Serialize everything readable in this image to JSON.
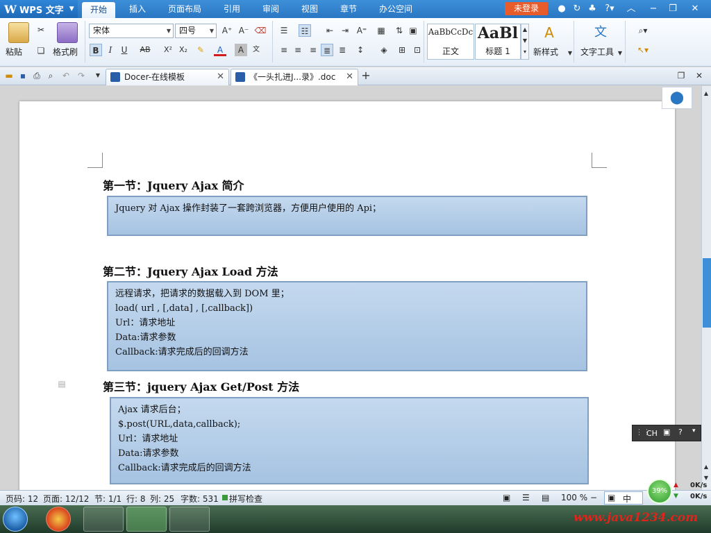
{
  "titlebar": {
    "app_name": "WPS 文字",
    "menu_tabs": [
      "开始",
      "插入",
      "页面布局",
      "引用",
      "审阅",
      "视图",
      "章节",
      "办公空间"
    ],
    "active_tab": "开始",
    "login_label": "未登录"
  },
  "ribbon": {
    "paste_label": "粘贴",
    "format_painter_label": "格式刷",
    "font_name": "宋体",
    "font_size": "四号",
    "styles": [
      {
        "sample": "AaBbCcDc",
        "name": "正文"
      },
      {
        "sample": "AaBl",
        "name": "标题 1"
      }
    ],
    "new_style_label": "新样式",
    "text_tools_label": "文字工具",
    "bold": "B",
    "italic": "I",
    "underline": "U",
    "strike": "AB",
    "superscript": "X²",
    "subscript": "X₂"
  },
  "tabs": [
    {
      "label": "Docer-在线模板"
    },
    {
      "label": "《一头扎进J...录》.doc"
    }
  ],
  "document": {
    "sections": [
      {
        "heading": "第一节：Jquery Ajax 简介",
        "lines": [
          "Jquery 对 Ajax 操作封装了一套跨浏览器，方便用户使用的 Api；"
        ]
      },
      {
        "heading": "第二节：Jquery Ajax Load 方法",
        "lines": [
          "远程请求，把请求的数据载入到 DOM 里；",
          "load( url , [,data] , [,callback])",
          "Url：请求地址",
          "Data:请求参数",
          "Callback:请求完成后的回调方法"
        ]
      },
      {
        "heading": "第三节：jquery Ajax Get/Post 方法",
        "lines": [
          "Ajax 请求后台；",
          "$.post(URL,data,callback);",
          "Url：请求地址",
          "Data:请求参数",
          "Callback:请求完成后的回调方法"
        ]
      }
    ]
  },
  "ime": {
    "label": "CH"
  },
  "statusbar": {
    "page_num": "页码: 12",
    "page_of": "页面: 12/12",
    "section": "节: 1/1",
    "row": "行: 8",
    "col": "列: 25",
    "word_count": "字数: 531",
    "spellcheck": "拼写检查",
    "zoom": "100 %",
    "ime_mode": "中"
  },
  "netmon": {
    "percent": "39%",
    "up": "0K/s",
    "down": "0K/s"
  },
  "watermark": "www.java1234.com",
  "colors": {
    "title_bar": "#2a77c4",
    "login_button": "#e85b2a",
    "box_fill": "#b5cfe9",
    "box_border": "#7f9fc2",
    "watermark": "#e0241b"
  }
}
